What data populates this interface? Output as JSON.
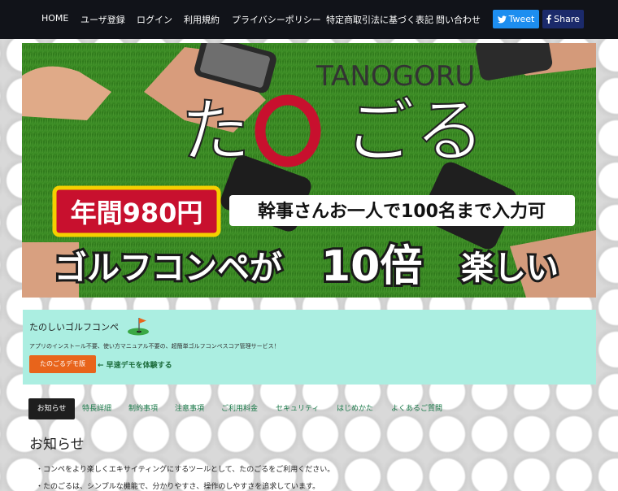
{
  "nav": {
    "items": [
      "HOME",
      "ユーザ登録",
      "ログイン",
      "利用規約",
      "プライバシーポリシー",
      "特定商取引法に基づく表記",
      "問い合わせ"
    ],
    "tweet_label": "Tweet",
    "share_label": "Share",
    "colors": {
      "bar": "#111319",
      "tweet": "#1d8ef0",
      "share": "#1b2a6b"
    }
  },
  "hero": {
    "brand_latin": "TANOGORU",
    "brand_kana_left": "た",
    "brand_kana_right": "ごる",
    "price_badge": "年間980円",
    "capacity_text": "幹事さんお一人で100名まで入力可",
    "headline_part1": "ゴルフコンペが",
    "headline_number": "10倍",
    "headline_part2": "楽しい"
  },
  "promo": {
    "title": "たのしいゴルフコンペ",
    "subtitle": "アプリのインストール不要、使い方マニュアル不要の、超簡単ゴルフコンペスコア管理サービス！",
    "demo_button": "たのごるデモ版",
    "demo_note": "← 早速デモを体験する",
    "icon": "golf-flag-icon"
  },
  "tabs": [
    "お知らせ",
    "特長詳細",
    "制約事項",
    "注意事項",
    "ご利用料金",
    "セキュリティ",
    "はじめかた",
    "よくあるご質問"
  ],
  "news": {
    "heading": "お知らせ",
    "lines": [
      "・コンペをより楽しくエキサイティングにするツールとして、たのごるをご利用ください。",
      "・たのごるは、シンプルな機能で、分かりやすさ、操作のしやすさを追求しています。"
    ]
  }
}
